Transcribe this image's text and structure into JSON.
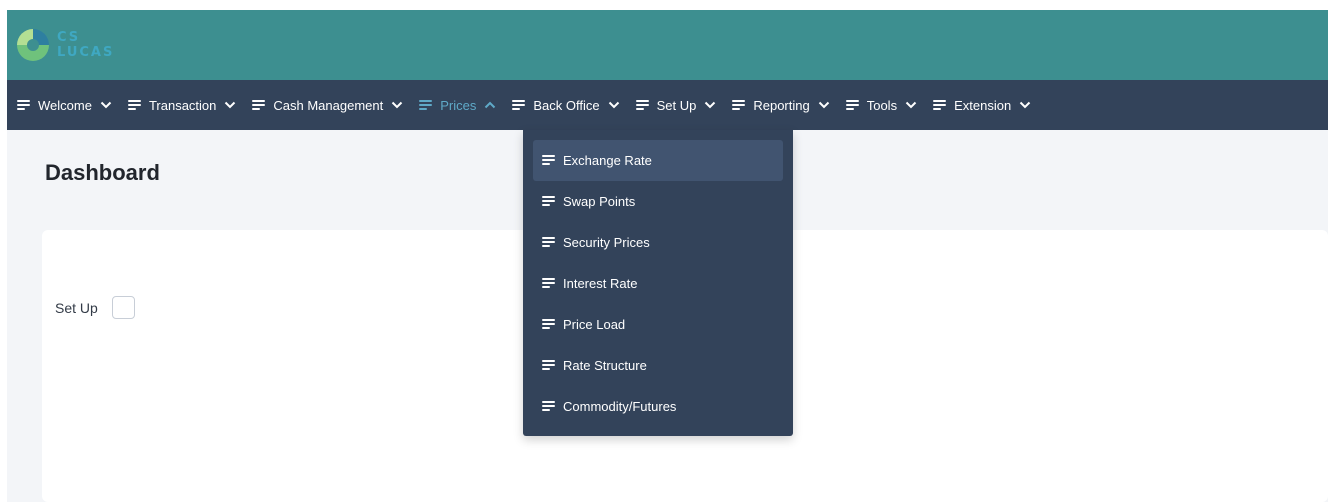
{
  "app": {
    "logo_line1": "CS",
    "logo_line2": "LUCAS"
  },
  "colors": {
    "header_bg": "#3d8f90",
    "nav_bg": "#33435a",
    "active_nav": "#5fa9c8",
    "page_bg": "#f3f5f8"
  },
  "nav": {
    "items": [
      {
        "label": "Welcome",
        "icon": "menu-lines-icon",
        "chevron": "chevron-down-icon"
      },
      {
        "label": "Transaction",
        "icon": "menu-lines-icon",
        "chevron": "chevron-down-icon"
      },
      {
        "label": "Cash Management",
        "icon": "menu-lines-icon",
        "chevron": "chevron-down-icon"
      },
      {
        "label": "Prices",
        "icon": "menu-lines-icon",
        "chevron": "chevron-up-icon",
        "active": true
      },
      {
        "label": "Back Office",
        "icon": "menu-lines-icon",
        "chevron": "chevron-down-icon"
      },
      {
        "label": "Set Up",
        "icon": "menu-lines-icon",
        "chevron": "chevron-down-icon"
      },
      {
        "label": "Reporting",
        "icon": "menu-lines-icon",
        "chevron": "chevron-down-icon"
      },
      {
        "label": "Tools",
        "icon": "menu-lines-icon",
        "chevron": "chevron-down-icon"
      },
      {
        "label": "Extension",
        "icon": "menu-lines-icon",
        "chevron": "chevron-down-icon"
      }
    ]
  },
  "dropdown": {
    "items": [
      {
        "label": "Exchange Rate",
        "selected": true
      },
      {
        "label": "Swap Points"
      },
      {
        "label": "Security Prices"
      },
      {
        "label": "Interest Rate"
      },
      {
        "label": "Price Load"
      },
      {
        "label": "Rate Structure"
      },
      {
        "label": "Commodity/Futures"
      }
    ]
  },
  "main": {
    "title": "Dashboard",
    "setup_label": "Set Up",
    "setup_checked": false
  }
}
